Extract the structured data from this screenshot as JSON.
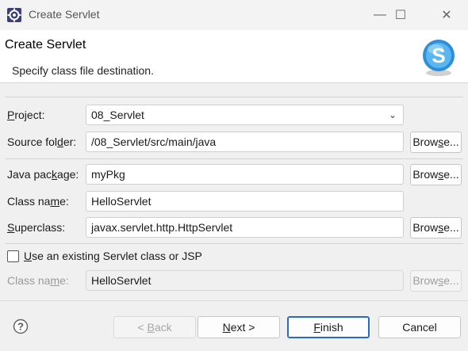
{
  "window": {
    "title": "Create Servlet",
    "minimize_glyph": "—",
    "maximize_glyph": "☐",
    "close_glyph": "✕",
    "icon": "eclipse-gear-icon"
  },
  "header": {
    "title": "Create Servlet",
    "description": "Specify class file destination.",
    "logo_letter": "S",
    "logo_colors": {
      "outer": "#2f8fd6",
      "inner": "#5ab6f0",
      "letter": "#ffffff"
    }
  },
  "form": {
    "project": {
      "label_pre": "",
      "label_ul": "P",
      "label_post": "roject:",
      "value": "08_Servlet",
      "chevron": "⌄"
    },
    "source_folder": {
      "label_pre": "Source fol",
      "label_ul": "d",
      "label_post": "er:",
      "value": "/08_Servlet/src/main/java",
      "browse_pre": "Brow",
      "browse_ul": "s",
      "browse_post": "e..."
    },
    "java_package": {
      "label_pre": "Java pac",
      "label_ul": "k",
      "label_post": "age:",
      "value": "myPkg",
      "browse_pre": "Brow",
      "browse_ul": "s",
      "browse_post": "e..."
    },
    "class_name": {
      "label_pre": "Class na",
      "label_ul": "m",
      "label_post": "e:",
      "value": "HelloServlet"
    },
    "superclass": {
      "label_pre": "",
      "label_ul": "S",
      "label_post": "uperclass:",
      "value": "javax.servlet.http.HttpServlet",
      "browse_pre": "Brow",
      "browse_ul": "s",
      "browse_post": "e..."
    },
    "use_existing": {
      "label_pre": "",
      "label_ul": "U",
      "label_post": "se an existing Servlet class or JSP",
      "checked": false
    },
    "existing_class": {
      "label_pre": "Class na",
      "label_ul": "m",
      "label_post": "e:",
      "value": "HelloServlet",
      "browse_pre": "Brow",
      "browse_ul": "s",
      "browse_post": "e..."
    }
  },
  "footer": {
    "help_glyph": "?",
    "back": {
      "pre": "< ",
      "ul": "B",
      "post": "ack"
    },
    "next": {
      "pre": "",
      "ul": "N",
      "post": "ext >"
    },
    "finish": {
      "pre": "",
      "ul": "F",
      "post": "inish"
    },
    "cancel": "Cancel"
  }
}
